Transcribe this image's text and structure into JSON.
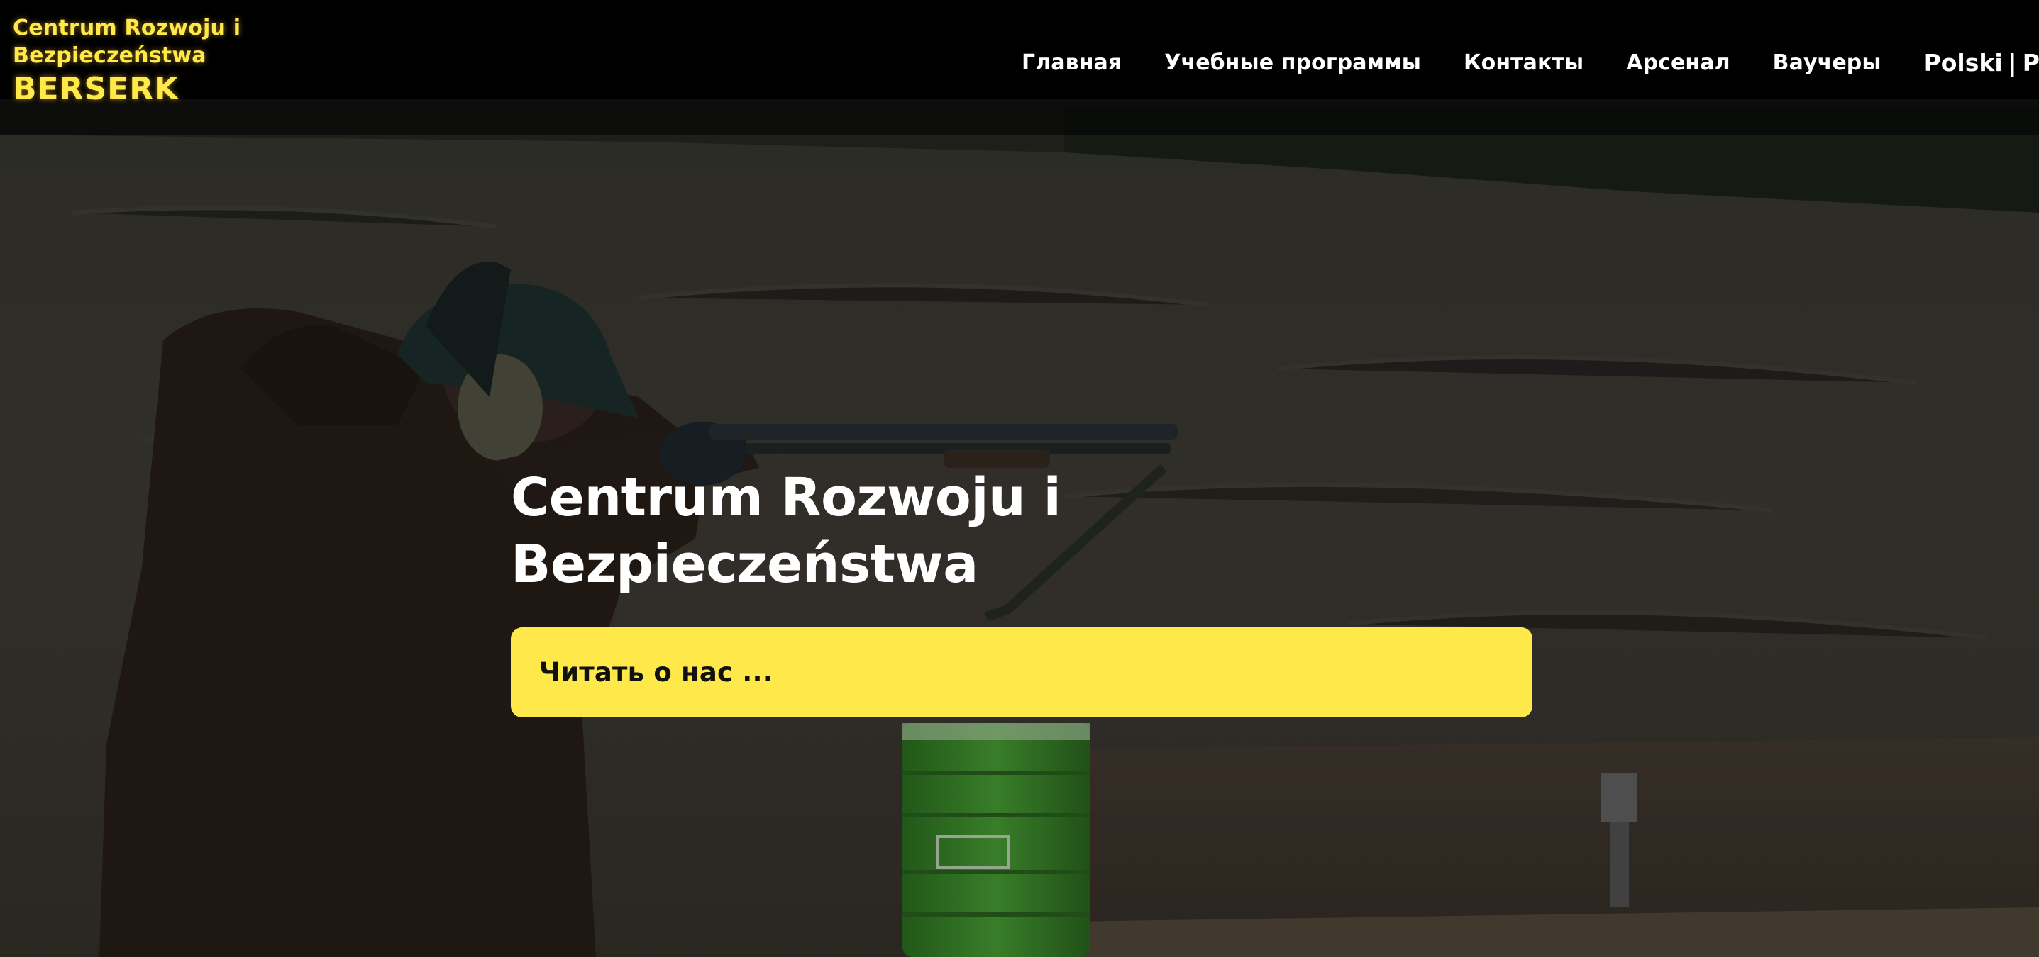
{
  "header": {
    "logo": {
      "line1": "Centrum Rozwoju i",
      "line2": "Bezpieczeństwa",
      "brand": "BERSERK"
    },
    "nav": [
      {
        "label": "Главная"
      },
      {
        "label": "Учебные программы"
      },
      {
        "label": "Контакты"
      },
      {
        "label": "Арсенал"
      },
      {
        "label": "Ваучеры"
      }
    ],
    "language": {
      "option1": "Polski",
      "separator": "|",
      "option2": "Русский"
    }
  },
  "hero": {
    "title_line1": "Centrum Rozwoju i",
    "title_line2": "Bezpieczeństwa",
    "cta_label": "Читать о нас ..."
  },
  "colors": {
    "accent": "#ffe94a",
    "header_bg": "#000000",
    "cta_text": "#111111"
  }
}
